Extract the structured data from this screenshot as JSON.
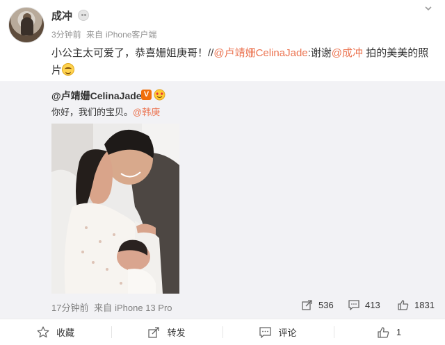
{
  "post": {
    "author": "成冲",
    "time": "3分钟前",
    "source_prefix": "来自",
    "source": "iPhone客户端",
    "text_main": "小公主太可爱了，恭喜姗姐庚哥！//",
    "text_mention_1": "@卢靖姗CelinaJade",
    "text_colon": ":谢谢",
    "text_mention_2": "@成冲",
    "text_tail": " 拍的美美的照片"
  },
  "repost": {
    "author": "@卢靖姗CelinaJade",
    "verified_badge": "V",
    "text": "你好，我们的宝贝。",
    "mention": "@韩庚",
    "time": "17分钟前",
    "source_prefix": "来自",
    "source": "iPhone 13 Pro",
    "stats": {
      "reposts": "536",
      "comments": "413",
      "likes": "1831"
    }
  },
  "actions": {
    "favorite": "收藏",
    "forward": "转发",
    "comment": "评论",
    "like": "1"
  },
  "colors": {
    "link": "#eb7350",
    "repost_bg": "#f2f2f5",
    "verified_orange": "#f06e0c"
  },
  "icons": [
    "chevron-down-icon",
    "badge-icon",
    "smile-emoji-icon",
    "verified-v-icon",
    "heart-eyes-icon",
    "share-icon",
    "comment-icon",
    "like-icon",
    "star-icon"
  ]
}
